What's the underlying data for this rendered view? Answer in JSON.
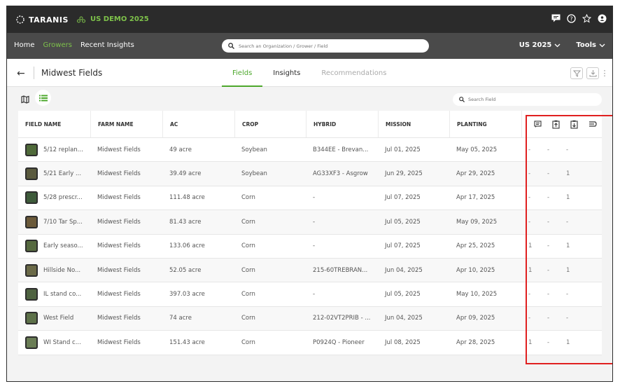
{
  "app": {
    "logo": "TARANIS",
    "org_name": "US DEMO 2025"
  },
  "nav": {
    "links": [
      "Home",
      "Growers",
      "Recent Insights"
    ],
    "active": "Growers",
    "search_placeholder": "Search an Organization / Grower / Field",
    "season": "US 2025",
    "tools": "Tools"
  },
  "subheader": {
    "title": "Midwest Fields",
    "tabs": [
      {
        "label": "Fields",
        "state": "active"
      },
      {
        "label": "Insights",
        "state": "normal"
      },
      {
        "label": "Recommendations",
        "state": "disabled"
      }
    ]
  },
  "search_field_placeholder": "Search Field",
  "table": {
    "headers": [
      "FIELD NAME",
      "FARM NAME",
      "AC",
      "CROP",
      "HYBRID",
      "MISSION",
      "PLANTING"
    ],
    "header_icons": [
      "report-icon",
      "clipboard-up-icon",
      "clipboard-down-icon",
      "sort-icon"
    ],
    "rows": [
      {
        "field": "5/12 replan...",
        "farm": "Midwest Fields",
        "ac": "49 acre",
        "crop": "Soybean",
        "hybrid": "B344EE - Brevan...",
        "mission": "Jul 01, 2025",
        "planting": "May 05, 2025",
        "i1": "-",
        "i2": "-",
        "i3": "-",
        "thumb": "#4f6a3a"
      },
      {
        "field": "5/21 Early ...",
        "farm": "Midwest Fields",
        "ac": "39.49 acre",
        "crop": "Soybean",
        "hybrid": "AG33XF3 - Asgrow",
        "mission": "Jun 29, 2025",
        "planting": "Apr 29, 2025",
        "i1": "-",
        "i2": "-",
        "i3": "1",
        "thumb": "#5a5a3e"
      },
      {
        "field": "5/28 prescr...",
        "farm": "Midwest Fields",
        "ac": "111.48 acre",
        "crop": "Corn",
        "hybrid": "-",
        "mission": "Jul 07, 2025",
        "planting": "Apr 17, 2025",
        "i1": "-",
        "i2": "-",
        "i3": "1",
        "thumb": "#3e5b3a"
      },
      {
        "field": "7/10 Tar Sp...",
        "farm": "Midwest Fields",
        "ac": "81.43 acre",
        "crop": "Corn",
        "hybrid": "-",
        "mission": "Jul 05, 2025",
        "planting": "May 09, 2025",
        "i1": "-",
        "i2": "-",
        "i3": "-",
        "thumb": "#6b5a3a"
      },
      {
        "field": "Early seaso...",
        "farm": "Midwest Fields",
        "ac": "133.06 acre",
        "crop": "Corn",
        "hybrid": "-",
        "mission": "Jul 07, 2025",
        "planting": "Apr 25, 2025",
        "i1": "1",
        "i2": "-",
        "i3": "1",
        "thumb": "#56693f"
      },
      {
        "field": "Hillside No...",
        "farm": "Midwest Fields",
        "ac": "52.05 acre",
        "crop": "Corn",
        "hybrid": "215-60TREBRAN...",
        "mission": "Jun 04, 2025",
        "planting": "Apr 10, 2025",
        "i1": "1",
        "i2": "-",
        "i3": "1",
        "thumb": "#6b6a48"
      },
      {
        "field": "IL stand co...",
        "farm": "Midwest Fields",
        "ac": "397.03 acre",
        "crop": "Corn",
        "hybrid": "-",
        "mission": "Jul 05, 2025",
        "planting": "May 10, 2025",
        "i1": "-",
        "i2": "-",
        "i3": "-",
        "thumb": "#4e6240"
      },
      {
        "field": "West Field",
        "farm": "Midwest Fields",
        "ac": "74 acre",
        "crop": "Corn",
        "hybrid": "212-02VT2PRIB - ...",
        "mission": "Jun 04, 2025",
        "planting": "Apr 09, 2025",
        "i1": "-",
        "i2": "-",
        "i3": "-",
        "thumb": "#5d7149"
      },
      {
        "field": "WI Stand c...",
        "farm": "Midwest Fields",
        "ac": "151.43 acre",
        "crop": "Corn",
        "hybrid": "P0924Q - Pioneer",
        "mission": "Jul 08, 2025",
        "planting": "Apr 28, 2025",
        "i1": "1",
        "i2": "-",
        "i3": "1",
        "thumb": "#6a7d55"
      }
    ]
  },
  "colors": {
    "accent": "#4da82c",
    "topbar": "#2b2b2b",
    "navbar": "#4a4a4a",
    "highlight": "#e02020"
  }
}
